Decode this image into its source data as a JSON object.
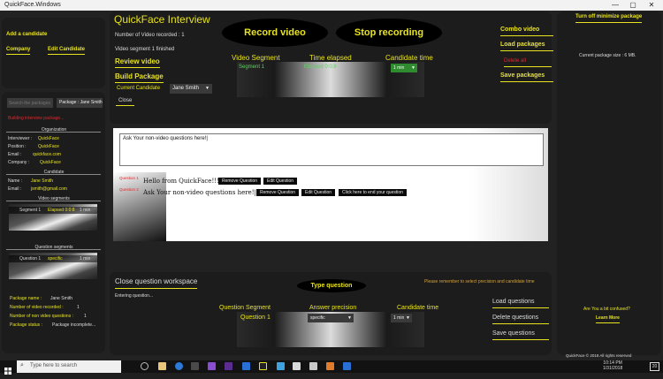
{
  "window": {
    "title": "QuickFace.Windows",
    "minimize_glyph": "—",
    "maximize_glyph": "▢",
    "close_glyph": "✕"
  },
  "left": {
    "add_candidate": "Add a candidate",
    "company": "Company",
    "edit_candidate": "Edit Candidate",
    "search_placeholder": "Search the packages",
    "package_chip": "Package : Jane Smith",
    "building_status": "Building interview package...",
    "organization": {
      "heading": "Organization",
      "rows": [
        {
          "label": "Interviewer :",
          "value": "QuickFace"
        },
        {
          "label": "Position :",
          "value": "QuickFace"
        },
        {
          "label": "Email :",
          "value": "quickface.com"
        },
        {
          "label": "Company :",
          "value": "QuickFace"
        }
      ]
    },
    "candidate": {
      "heading": "Candidate",
      "rows": [
        {
          "label": "Name :",
          "value": "Jane Smith"
        },
        {
          "label": "Email :",
          "value": "jsmith@gmail.com"
        }
      ]
    },
    "video_segments": {
      "heading": "Video segments",
      "row": {
        "segment": "Segment 1",
        "elapsed": "Elapsed 0:0:8",
        "time": "1 min"
      }
    },
    "question_segments": {
      "heading": "Question segments",
      "row": {
        "segment": "Question 1",
        "precision": "specific",
        "time": "1 min"
      }
    },
    "package_info": [
      {
        "label": "Package name :",
        "value": "Jane Smith"
      },
      {
        "label": "Number of video recorded :",
        "value": "1"
      },
      {
        "label": "Number of non video questions :",
        "value": "1"
      },
      {
        "label": "Package status :",
        "value": "Package incomplete..."
      }
    ]
  },
  "top": {
    "title": "QuickFace Interview",
    "videos_recorded": "Number of Video recorded : 1",
    "segment_finished": "Video segment 1 finished",
    "review_video": "Review video",
    "build_package": "Build Package",
    "current_candidate_label": "Current Candidate",
    "current_candidate_value": "Jane Smith",
    "record_video": "Record video",
    "stop_recording": "Stop recording",
    "col_video_segment": "Video Segment",
    "col_time_elapsed": "Time elapsed",
    "col_candidate_time": "Candidate time",
    "segment_row": {
      "segment": "Segment 1",
      "elapsed": "Elapsed 0:0:8",
      "time": "1 min"
    },
    "close": "Close"
  },
  "right_buttons": {
    "combo_video": "Combo video",
    "load_packages": "Load packages",
    "delete_all": "Delete all",
    "save_packages": "Save packages"
  },
  "far_right": {
    "turn_off_minimize": "Turn off minimize package",
    "package_size": "Current package size : 6 MB.",
    "confused": "Are You a bit confused?",
    "learn_more": "Learn More",
    "copyright": "QuickFace © 2018 All rights reserved"
  },
  "questions": {
    "input_value": "Ask Your non-video questions here!|",
    "q1_label": "Question 1",
    "q1_text": "Hello from QuickFace!!!",
    "q2_label": "Question 2",
    "q2_text": "Ask Your non-video questions here!|",
    "remove": "Remove Question",
    "edit": "Edit Question",
    "end_question": "Click here to end your question"
  },
  "bottom": {
    "close_workspace": "Close question workspace",
    "entering": "Entering question...",
    "type_question": "Type question",
    "reminder": "Please remember to select precision and candidate time",
    "col_question_segment": "Question Segment",
    "col_answer_precision": "Answer precision",
    "col_candidate_time": "Candidate time",
    "row": {
      "segment": "Question 1",
      "precision": "specific",
      "time": "1 min"
    },
    "load_questions": "Load questions",
    "delete_questions": "Delete questions",
    "save_questions": "Save questions"
  },
  "taskbar": {
    "search_placeholder": "Type here to search",
    "time": "10:14 PM",
    "date": "1/31/2018",
    "notification_count": "20"
  },
  "icons": {
    "windows": "windows-logo-icon",
    "search": "search-icon",
    "dropdown": "chevron-down-icon"
  }
}
